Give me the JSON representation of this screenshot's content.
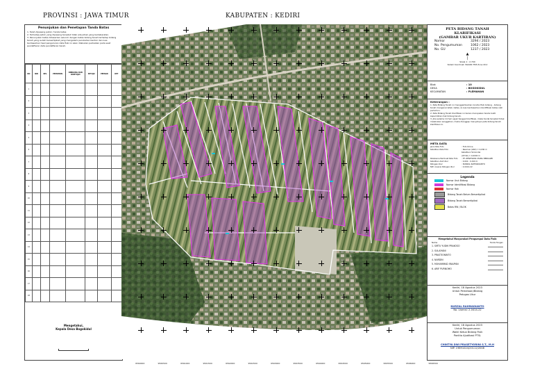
{
  "header": {
    "province": "PROVINSI : JAWA TIMUR",
    "regency": "KABUPATEN : KEDIRI"
  },
  "left_panel": {
    "title": "Penunjukan dan Penetapan Tanda Batas",
    "notes": [
      "1. Telah dipasang patok / tanda batas",
      "2. Terhadap patok yang dipasang tersebut tidak ada pihak yang berkeberatan.",
      "3. Penunjukan batas didasarkan seluruh dengan batas bidang tanah terhadap bidang tanah yang sudah bersertipikat yang mengalami perubahan bentuk dan luas berdasarkan hasil pengukuran data fisik ini akan dilakukan perbaikan pada saat pendaftaran data pendaftaran tanah."
    ],
    "columns": [
      "NO",
      "NIB",
      "KEL",
      "PEMOHON",
      "DIBIDANG DAN DISETUJUI",
      "SETUJU",
      "PEMILIK",
      "KET"
    ],
    "rows": [
      "1",
      "2",
      "3",
      "4",
      "5",
      "6",
      "7",
      "8",
      "9",
      "10",
      "11",
      "12",
      "13",
      "14",
      "15",
      "16",
      "17",
      "18"
    ],
    "signature": [
      "Mengetahui,",
      "Kepala Desa Bogokidul"
    ]
  },
  "map": {
    "grid_labels": [
      "9560000",
      "9560500",
      "9561000",
      "9561500",
      "9562000",
      "9562500",
      "9563000",
      "9563500",
      "9564000",
      "9564500",
      "9565000",
      "9565500",
      "9566000",
      "9566500"
    ]
  },
  "right_panel": {
    "title": [
      "PETA BIDANG TANAH",
      "KLARIFIKASI",
      "(GAMBAR UKUR KARTIRAN)"
    ],
    "fields": [
      {
        "label": "Nomor",
        "value": "3294 / 2023"
      },
      {
        "label": "No. Pengumuman",
        "value": "1062 / 2023"
      },
      {
        "label": "No. GU",
        "value": "1237 / 2023"
      }
    ],
    "scale": "Skala  1 : 2.700",
    "system": "Sistem Koordinat: WGS84 TM3 Zone 49.2",
    "location": [
      {
        "label": "Blok",
        "value": ": 10"
      },
      {
        "label": "DESA",
        "value": ": BOGOKIDUL"
      },
      {
        "label": "KECAMATAN",
        "value": ": PLEMAHAN"
      }
    ],
    "notes_title": "Keterangan :",
    "notes": [
      "1. Peta Bidang Tanah ini menggambarkan kondisi fisik bidang - bidang tanah mengenai letak, batas, & luas berdasarkan identifikasi batas oleh pemohon.",
      "2. Peta Bidang Tanah Klarifikasi ini bukan merupakan tanda bukti kepemilikan hak bidang tanah.",
      "3. Jika selama 14 hari sejak tanggal klarifikasi, maka tanda tersebut tidak melakukan sanggahan, maka dianggap menyetujui peta bidang tanah klarifikasi ini."
    ],
    "meta_title": "META DATA",
    "meta": [
      {
        "label": "Jenis Peta Foto",
        "value": ": Foto Drone"
      },
      {
        "label": "Ketelitian Peta Foto",
        "value": ": Resolusi (GSD) = 0,036 m"
      },
      {
        "label": "",
        "value": "  Ketelitian Horizontal"
      },
      {
        "label": "",
        "value": "  (CE 90) = 0,0000 m"
      },
      {
        "label": "Pelaksana Pembuat Peta Foto",
        "value": ": PT. ZENITSRIN UTAMA BERKAZEI"
      },
      {
        "label": "Ketelitian Alat Ukur",
        "value": ": 0,002 - 0,010 m"
      },
      {
        "label": "Petugas Ukur",
        "value": ": NURZAL RAHMADIANTO"
      },
      {
        "label": "NIP / Lisensi Petugas Ukur",
        "value": ": 2-0414-22"
      }
    ],
    "legend_title": "Legenda",
    "legend": [
      {
        "label": "Nomor Urut Bidang",
        "color": "#18c4d8"
      },
      {
        "label": "Nomor Identifikasi Bidang",
        "color": "#d23ad8"
      },
      {
        "label": "Nomor Hak",
        "color": "#e03030"
      },
      {
        "label": "Bidang Tanah Belum Bersertipikat",
        "color": "#9a9a9a"
      },
      {
        "label": "Bidang Tanah Bersertipikat",
        "color": "#a06ac0"
      },
      {
        "label": "Batas RW / BLOK",
        "color": "#e6e24a"
      }
    ],
    "sign_title": "Mengetahui Masyarakat Pengumpul Data Fisik",
    "sign_headers": [
      "Nama",
      "Tanda Tangan"
    ],
    "sign_names": [
      "1. SIRTU YUDHI PRAKOSO",
      "2. SULAIYANI",
      "3. PRASTIONINTO",
      "4. NARDIN",
      "5. MUHAMMAD IRAUPAN",
      "6. ARIF PURNOMO"
    ],
    "survey_date": "Kediri, 18 Agustus 2023",
    "survey_role": [
      "Untuk Pemetaan/Bidang",
      "Petugas Ukur"
    ],
    "surveyor_name": "NURZAL RAHMADIANTO",
    "surveyor_license": "No. Lisensi: 2-0414-22",
    "head_date": "Kediri, 18 Agustus 2023",
    "head_role": [
      "Untuk Pengumuman",
      "Wakil Ketua Bidang Fisik",
      "Panitia Ajudikasi PTSL"
    ],
    "head_name": "CHINTYA DWI PRASETYORINI S.T., M.H",
    "head_nip": "NIP. 19891024/20112/2008"
  }
}
